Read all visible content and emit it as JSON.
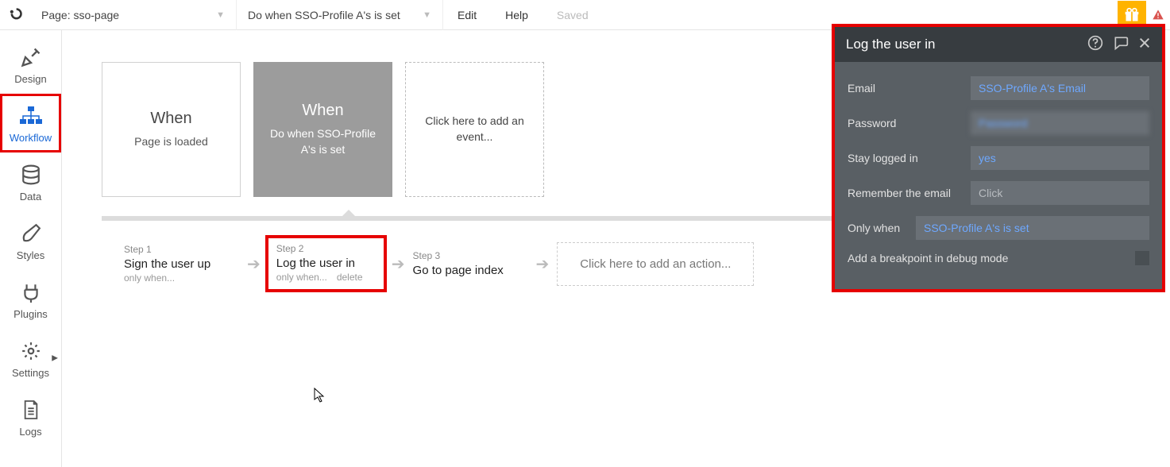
{
  "topbar": {
    "page_dropdown_label": "Page: sso-page",
    "event_dropdown_label": "Do when SSO-Profile A's is set",
    "edit": "Edit",
    "help": "Help",
    "saved": "Saved"
  },
  "sidebar": {
    "design": "Design",
    "workflow": "Workflow",
    "data": "Data",
    "styles": "Styles",
    "plugins": "Plugins",
    "settings": "Settings",
    "logs": "Logs"
  },
  "events": [
    {
      "when": "When",
      "desc": "Page is loaded"
    },
    {
      "when": "When",
      "desc": "Do when SSO-Profile A's is set"
    },
    {
      "add_text": "Click here to add an event..."
    }
  ],
  "steps": {
    "step1_num": "Step 1",
    "step1_title": "Sign the user up",
    "step1_sub": "only when...",
    "step2_num": "Step 2",
    "step2_title": "Log the user in",
    "step2_sub_only": "only when...",
    "step2_sub_delete": "delete",
    "step3_num": "Step 3",
    "step3_title": "Go to page index",
    "add_action": "Click here to add an action..."
  },
  "panel": {
    "title": "Log the user in",
    "email_label": "Email",
    "email_value": "SSO-Profile A's Email",
    "password_label": "Password",
    "password_value": "Password",
    "stay_label": "Stay logged in",
    "stay_value": "yes",
    "remember_label": "Remember the email",
    "remember_placeholder": "Click",
    "onlywhen_label": "Only when",
    "onlywhen_value": "SSO-Profile A's is set",
    "breakpoint_label": "Add a breakpoint in debug mode"
  }
}
